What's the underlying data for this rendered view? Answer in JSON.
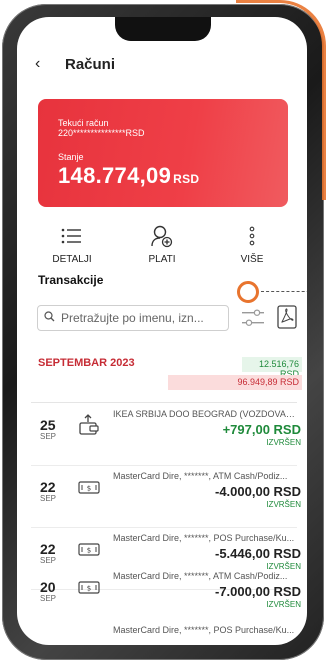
{
  "header": {
    "back_glyph": "‹",
    "title": "Računi"
  },
  "account_card": {
    "name": "Tekući račun",
    "number": "220***************RSD",
    "balance_label": "Stanje",
    "balance": "148.774,09",
    "currency": "RSD",
    "color": "#e7333d"
  },
  "actions": [
    {
      "label": "DETALJI",
      "icon": "list-icon"
    },
    {
      "label": "PLATI",
      "icon": "pay-user-icon"
    },
    {
      "label": "VIŠE",
      "icon": "more-vertical-icon"
    }
  ],
  "transactions_section": {
    "title": "Transakcije",
    "search_placeholder": "Pretražujte po imenu, izn..."
  },
  "month_group": {
    "label": "SEPTEMBAR 2023",
    "income": "12.516,76 RSD",
    "expense": "96.949,89 RSD"
  },
  "transactions": [
    {
      "day": "25",
      "month": "SEP",
      "icon": "deposit-icon",
      "description": "IKEA SRBIJA DOO BEOGRAD (VOZDOVAC),...",
      "amount": "+797,00 RSD",
      "positive": true,
      "status": "IZVRŠEN"
    },
    {
      "day": "22",
      "month": "SEP",
      "icon": "cash-icon",
      "description": "MasterCard Dire, *******, ATM Cash/Podiz...",
      "amount": "-4.000,00 RSD",
      "positive": false,
      "status": "IZVRŠEN"
    },
    {
      "day": "22",
      "month": "SEP",
      "icon": "cash-icon",
      "description": "MasterCard Dire, *******, POS Purchase/Ku...",
      "amount": "-5.446,00 RSD",
      "positive": false,
      "status": "IZVRŠEN"
    },
    {
      "day": "20",
      "month": "SEP",
      "icon": "cash-icon",
      "description": "MasterCard Dire, *******, ATM Cash/Podiz...",
      "amount": "-7.000,00 RSD",
      "positive": false,
      "status": "IZVRŠEN"
    },
    {
      "day": "",
      "month": "",
      "icon": "",
      "description": "MasterCard Dire, *******, POS Purchase/Ku...",
      "amount": "",
      "positive": false,
      "status": ""
    }
  ],
  "colors": {
    "accent": "#e7333d",
    "positive": "#1f8a3b",
    "highlight": "#e8742e"
  }
}
